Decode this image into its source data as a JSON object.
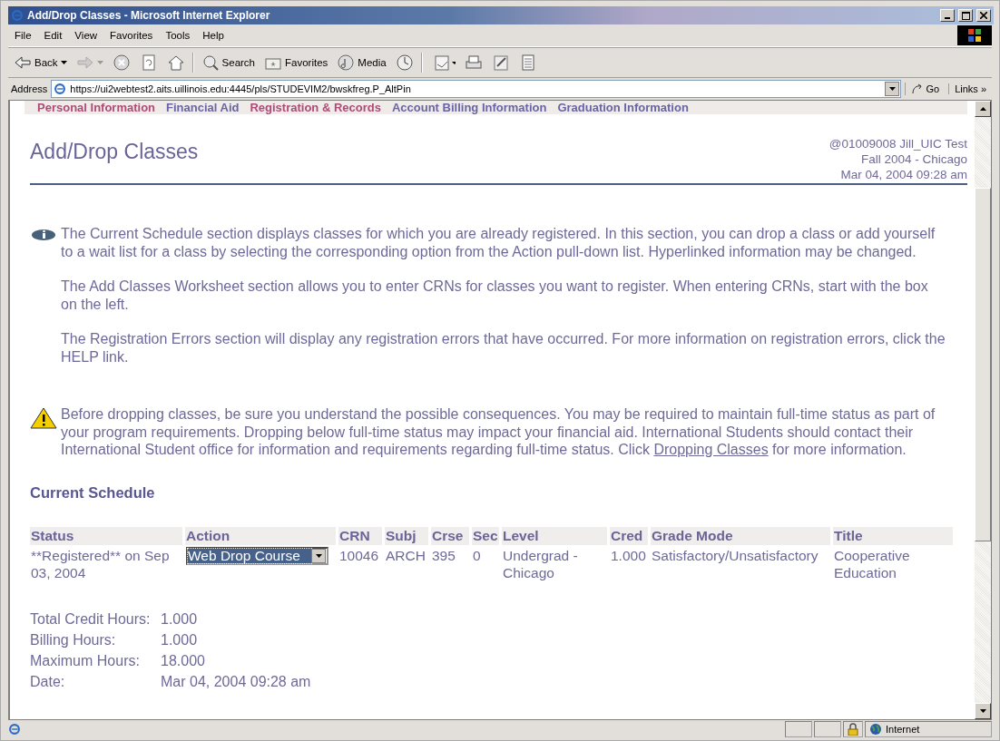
{
  "window": {
    "title": "Add/Drop Classes - Microsoft Internet Explorer"
  },
  "menu": [
    "File",
    "Edit",
    "View",
    "Favorites",
    "Tools",
    "Help"
  ],
  "toolbar": [
    {
      "kind": "back",
      "label": "Back"
    },
    {
      "kind": "forward"
    },
    {
      "kind": "stop"
    },
    {
      "kind": "refresh"
    },
    {
      "kind": "home"
    },
    {
      "kind": "search",
      "label": "Search"
    },
    {
      "kind": "favorites",
      "label": "Favorites"
    },
    {
      "kind": "media",
      "label": "Media"
    },
    {
      "kind": "history"
    },
    {
      "kind": "mail"
    },
    {
      "kind": "print"
    },
    {
      "kind": "edit"
    },
    {
      "kind": "discuss"
    }
  ],
  "address": {
    "label": "Address",
    "value": "https://ui2webtest2.aits.uillinois.edu:4445/pls/STUDEVIM2/bwskfreg.P_AltPin",
    "go": "Go",
    "links": "Links",
    "more": "»"
  },
  "nav": [
    {
      "label": "Personal Information",
      "color": "#b04a78"
    },
    {
      "label": "Financial Aid",
      "color": "#6a64a4"
    },
    {
      "label": "Registration & Records",
      "color": "#b04a78"
    },
    {
      "label": "Account Billing Information",
      "color": "#6a64a4"
    },
    {
      "label": "Graduation Information",
      "color": "#6a64a4"
    }
  ],
  "page": {
    "title": "Add/Drop Classes",
    "user": "@01009008 Jill_UIC Test",
    "term": "Fall 2004 - Chicago",
    "timestamp": "Mar 04, 2004 09:28 am"
  },
  "info": [
    "The Current Schedule section displays classes for which you are already registered. In this section, you can drop a class or add yourself to a wait list for a class by selecting the corresponding option from the Action pull-down list. Hyperlinked information may be changed.",
    "The Add Classes Worksheet section allows you to enter CRNs for classes you want to register. When entering CRNs, start with the box on the left.",
    "The Registration Errors section will display any registration errors that have occurred. For more information on registration errors, click the HELP link."
  ],
  "warning": {
    "before": "Before dropping classes, be sure you understand the possible consequences. You may be required to maintain full-time status as part of your program requirements. Dropping below full-time status may impact your financial aid. International Students should contact their International Student office for information and requirements regarding full-time status. Click",
    "link": "Dropping Classes",
    "after": "for more information."
  },
  "schedule": {
    "heading": "Current Schedule",
    "columns": [
      "Status",
      "Action",
      "CRN",
      "Subj",
      "Crse",
      "Sec",
      "Level",
      "Cred",
      "Grade Mode",
      "Title"
    ],
    "rows": [
      {
        "status": "**Registered** on Sep 03, 2004",
        "action": "Web Drop Course",
        "crn": "10046",
        "subj": "ARCH",
        "crse": "395",
        "sec": "0",
        "level": "Undergrad - Chicago",
        "cred": "1.000",
        "grade_mode": "Satisfactory/Unsatisfactory",
        "title": "Cooperative Education"
      }
    ]
  },
  "totals": [
    {
      "label": "Total Credit Hours:",
      "value": "1.000"
    },
    {
      "label": "Billing Hours:",
      "value": "1.000"
    },
    {
      "label": "Maximum Hours:",
      "value": "18.000"
    },
    {
      "label": "Date:",
      "value": "Mar 04, 2004 09:28 am"
    }
  ],
  "status_bar": {
    "zone": "Internet"
  }
}
